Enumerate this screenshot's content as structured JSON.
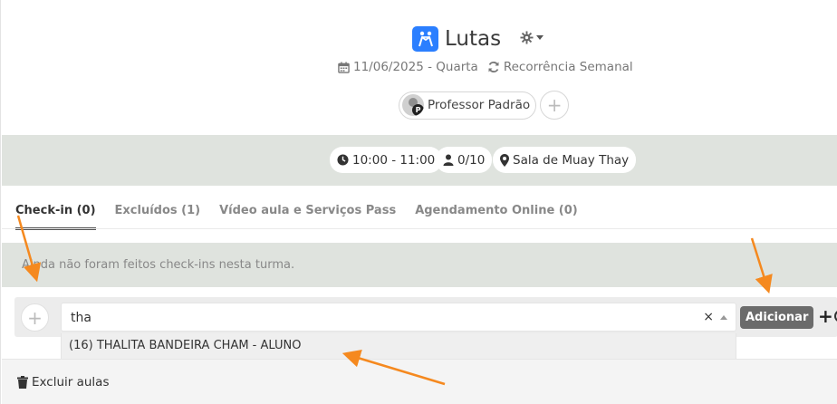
{
  "header": {
    "title": "Lutas",
    "app_icon": "wrestling-icon",
    "settings_icon": "gear-icon",
    "date": "11/06/2025 - Quarta",
    "recurrence": "Recorrência Semanal",
    "teacher": "Professor Padrão",
    "teacher_badge": "P"
  },
  "info": {
    "time": "10:00 - 11:00",
    "capacity": "0/10",
    "room": "Sala de Muay Thay"
  },
  "tabs": [
    {
      "label": "Check-in (0)",
      "active": true
    },
    {
      "label": "Excluídos (1)",
      "active": false
    },
    {
      "label": "Vídeo aula e Serviços Pass",
      "active": false
    },
    {
      "label": "Agendamento Online (0)",
      "active": false
    }
  ],
  "alert": {
    "text": "Ainda não foram feitos check-ins nesta turma."
  },
  "add_row": {
    "search_value": "tha",
    "clear_label": "×",
    "add_button": "Adicionar"
  },
  "dropdown": {
    "options": [
      "(16) THALITA BANDEIRA CHAM - ALUNO"
    ]
  },
  "footer": {
    "delete_label": "Excluir aulas"
  },
  "colors": {
    "accent": "#2b7fff",
    "band": "#dfe3de",
    "annotation_arrow": "#f5891f",
    "button_dark": "#6b6b6b"
  }
}
